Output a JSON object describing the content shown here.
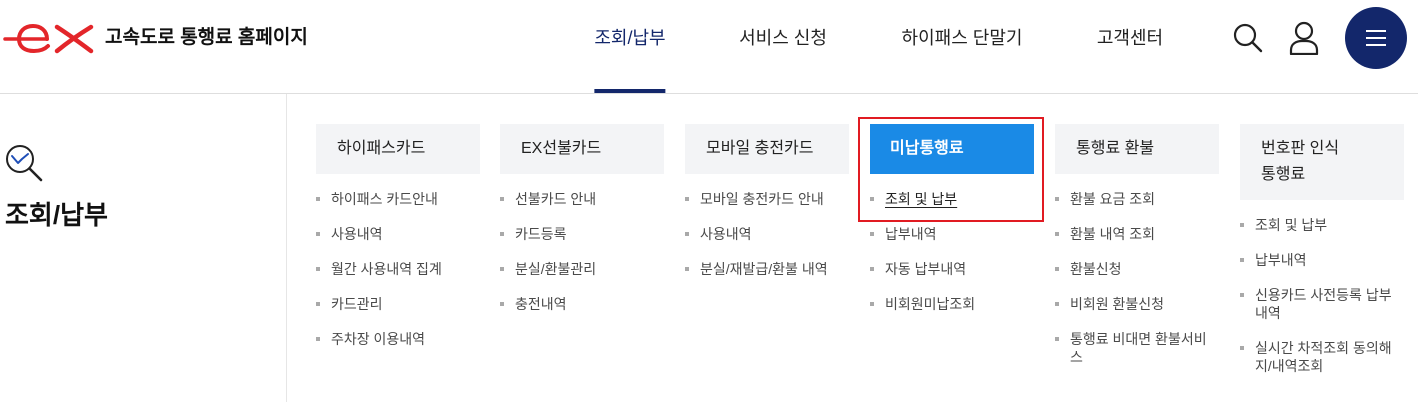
{
  "colors": {
    "navy": "#13276b",
    "highlight_blue": "#1a8ae6",
    "annotation_red": "#e11b22",
    "logo_red": "#e3262a"
  },
  "header": {
    "logo": {
      "text": "ex",
      "icon": "ex-logo"
    },
    "site_title": "고속도로 통행료 홈페이지",
    "nav": [
      {
        "label": "조회/납부",
        "active": true
      },
      {
        "label": "서비스 신청"
      },
      {
        "label": "하이패스 단말기"
      },
      {
        "label": "고객센터"
      }
    ],
    "icons": {
      "search": "search-icon",
      "user": "user-icon",
      "menu": "hamburger-menu-icon"
    }
  },
  "side": {
    "icon": "search-check-icon",
    "title": "조회/납부"
  },
  "menu": {
    "columns": [
      {
        "title": "하이패스카드",
        "items": [
          {
            "label": "하이패스 카드안내"
          },
          {
            "label": "사용내역"
          },
          {
            "label": "월간 사용내역 집계"
          },
          {
            "label": "카드관리"
          },
          {
            "label": "주차장 이용내역"
          }
        ]
      },
      {
        "title": "EX선불카드",
        "items": [
          {
            "label": "선불카드 안내"
          },
          {
            "label": "카드등록"
          },
          {
            "label": "분실/환불관리"
          },
          {
            "label": "충전내역"
          }
        ]
      },
      {
        "title": "모바일 충전카드",
        "items": [
          {
            "label": "모바일 충전카드 안내"
          },
          {
            "label": "사용내역"
          },
          {
            "label": "분실/재발급/환불 내역"
          }
        ]
      },
      {
        "title": "미납통행료",
        "highlighted": true,
        "items": [
          {
            "label": "조회 및 납부",
            "selected": true
          },
          {
            "label": "납부내역"
          },
          {
            "label": "자동 납부내역"
          },
          {
            "label": "비회원미납조회"
          }
        ]
      },
      {
        "title": "통행료 환불",
        "items": [
          {
            "label": "환불 요금 조회"
          },
          {
            "label": "환불 내역 조회"
          },
          {
            "label": "환불신청"
          },
          {
            "label": "비회원 환불신청"
          },
          {
            "label": "통행료 비대면 환불서비스"
          }
        ]
      },
      {
        "title": "번호판 인식 통행료",
        "items": [
          {
            "label": "조회 및 납부"
          },
          {
            "label": "납부내역"
          },
          {
            "label": "신용카드 사전등록 납부내역"
          },
          {
            "label": "실시간 차적조회 동의해지/내역조회"
          }
        ]
      }
    ]
  }
}
